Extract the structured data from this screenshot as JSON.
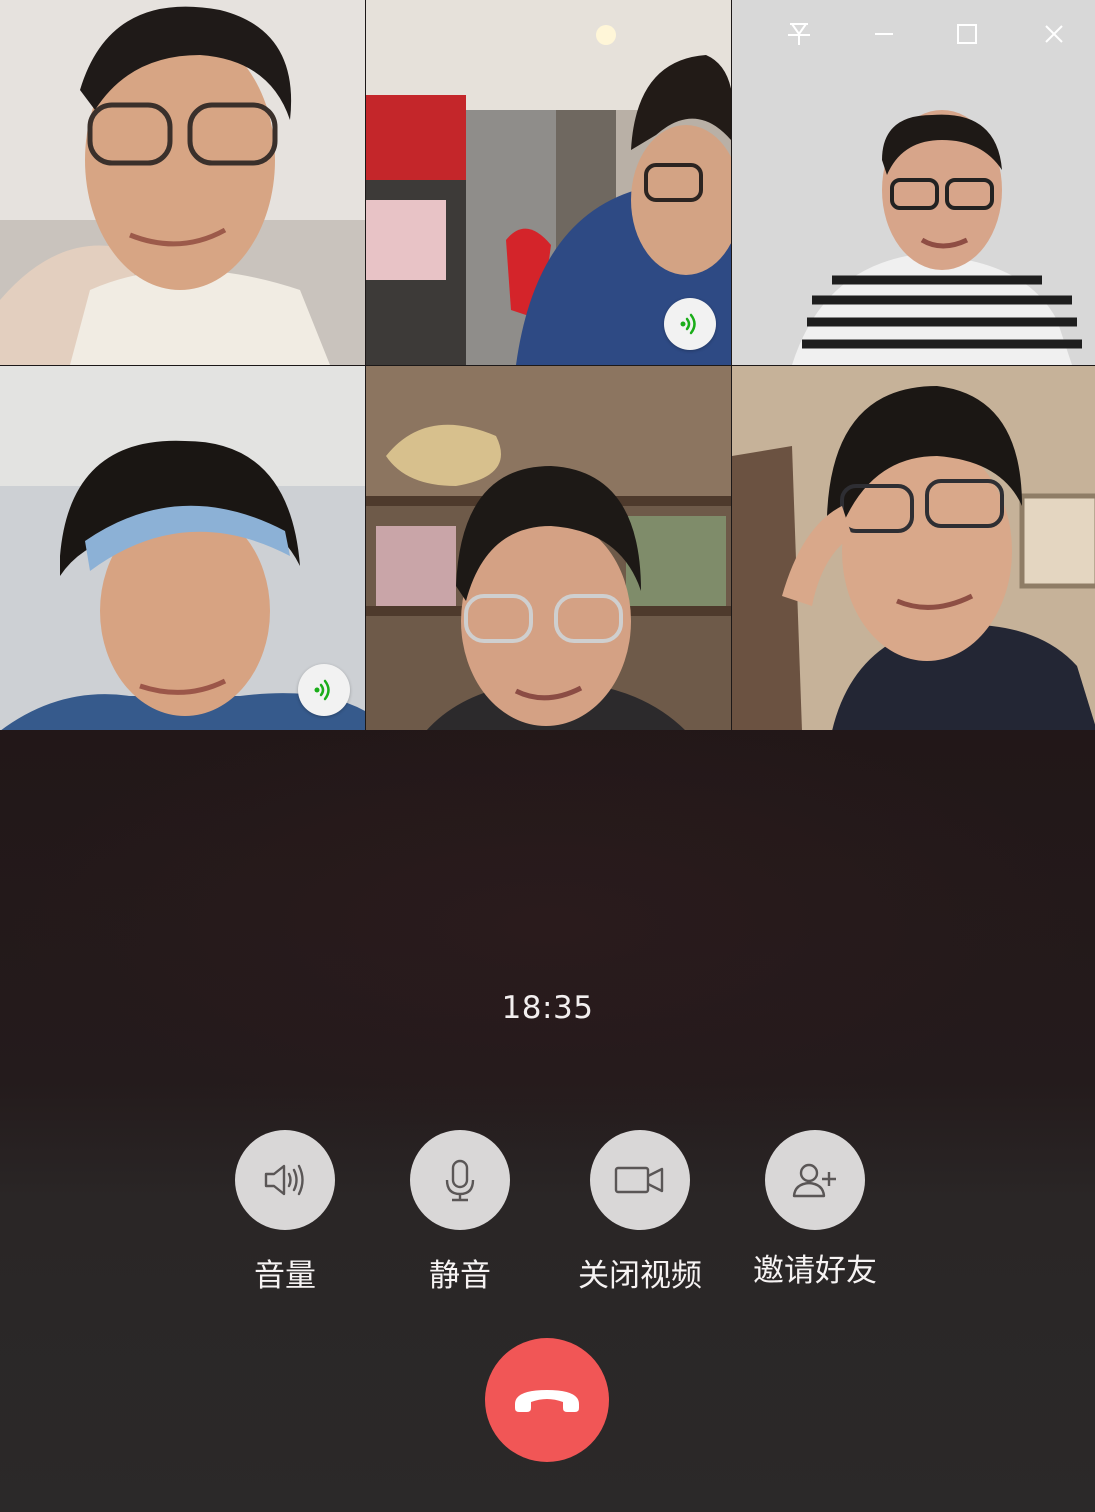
{
  "window": {
    "controls": {
      "pin_icon": "pin-icon",
      "minimize_icon": "minimize-icon",
      "maximize_icon": "maximize-icon",
      "close_icon": "close-icon"
    }
  },
  "participants": [
    {
      "speaking": false
    },
    {
      "speaking": true
    },
    {
      "speaking": false
    },
    {
      "speaking": true
    },
    {
      "speaking": false
    },
    {
      "speaking": false
    }
  ],
  "call": {
    "duration": "18:35"
  },
  "controls": {
    "volume_label": "音量",
    "mute_label": "静音",
    "video_off_label": "关闭视频",
    "invite_label": "邀请好友"
  },
  "colors": {
    "hangup": "#f15656",
    "speaking_indicator": "#1aad19",
    "control_circle": "#d9d7d7"
  }
}
